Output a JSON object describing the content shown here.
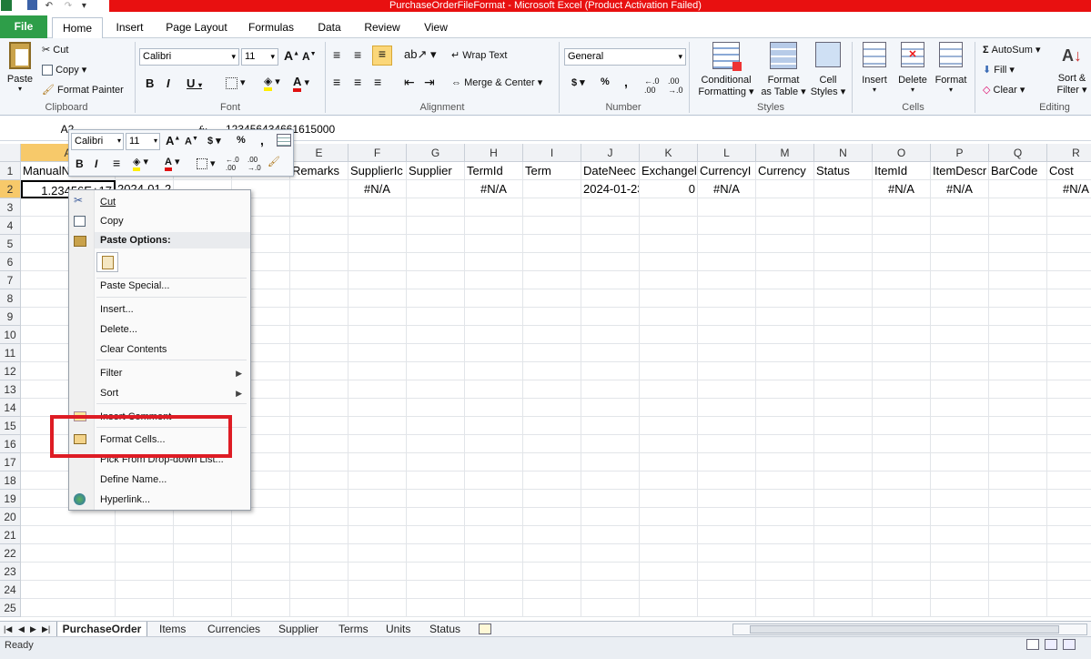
{
  "window": {
    "title": "PurchaseOrderFileFormat  -  Microsoft Excel (Product Activation Failed)"
  },
  "ribbon_tabs": [
    "File",
    "Home",
    "Insert",
    "Page Layout",
    "Formulas",
    "Data",
    "Review",
    "View"
  ],
  "clipboard": {
    "paste": "Paste",
    "cut": "Cut",
    "copy": "Copy",
    "format_painter": "Format Painter",
    "label": "Clipboard"
  },
  "font": {
    "name": "Calibri",
    "size": "11",
    "label": "Font"
  },
  "alignment": {
    "wrap": "Wrap Text",
    "merge": "Merge & Center",
    "label": "Alignment"
  },
  "number": {
    "format": "General",
    "label": "Number"
  },
  "styles": {
    "conditional": "Conditional",
    "conditional2": "Formatting",
    "format_table": "Format",
    "format_table2": "as Table",
    "cell_styles": "Cell",
    "cell_styles2": "Styles",
    "label": "Styles"
  },
  "cells": {
    "insert": "Insert",
    "delete": "Delete",
    "format": "Format",
    "label": "Cells"
  },
  "editing": {
    "autosum": "AutoSum",
    "fill": "Fill",
    "clear": "Clear",
    "sort": "Sort &",
    "sort2": "Filter",
    "label": "Editing"
  },
  "formula_bar": {
    "name_box": "A2",
    "fx": "fx",
    "content": "123456434661615000"
  },
  "columns": [
    "A",
    "B",
    "C",
    "D",
    "E",
    "F",
    "G",
    "H",
    "I",
    "J",
    "K",
    "L",
    "M",
    "N",
    "O",
    "P",
    "Q",
    "R"
  ],
  "rows": [
    "1",
    "2",
    "3",
    "4",
    "5",
    "6",
    "7",
    "8",
    "9",
    "10",
    "11",
    "12",
    "13",
    "14",
    "15",
    "16",
    "17",
    "18",
    "19",
    "20",
    "21",
    "22",
    "23",
    "24",
    "25"
  ],
  "row1": [
    "ManualN",
    "",
    "",
    "",
    "Remarks",
    "SupplierIc",
    "Supplier",
    "TermId",
    "Term",
    "DateNeec",
    "Exchangel",
    "CurrencyI",
    "Currency",
    "Status",
    "ItemId",
    "ItemDescr",
    "BarCode",
    "Cost"
  ],
  "row2": [
    "1.23456E+17",
    "2024-01-2",
    "",
    "",
    "",
    "#N/A",
    "",
    "#N/A",
    "",
    "2024-01-23",
    "0",
    "#N/A",
    "",
    "",
    "#N/A",
    "#N/A",
    "",
    "#N/A"
  ],
  "mini_toolbar": {
    "font": "Calibri",
    "size": "11"
  },
  "context_menu": {
    "cut": "Cut",
    "copy": "Copy",
    "paste_options": "Paste Options:",
    "paste_special": "Paste Special...",
    "insert": "Insert...",
    "delete": "Delete...",
    "clear": "Clear Contents",
    "filter": "Filter",
    "sort": "Sort",
    "insert_comment": "Insert Comment",
    "format_cells": "Format Cells...",
    "pick_list": "Pick From Drop-down List...",
    "define_name": "Define Name...",
    "hyperlink": "Hyperlink..."
  },
  "sheets": [
    "PurchaseOrder",
    "Items",
    "Currencies",
    "Supplier",
    "Terms",
    "Units",
    "Status"
  ],
  "status": {
    "text": "Ready"
  },
  "colors": {
    "file_tab": "#2e9e49",
    "title_bar": "#e81010",
    "highlight": "#de1c24"
  }
}
